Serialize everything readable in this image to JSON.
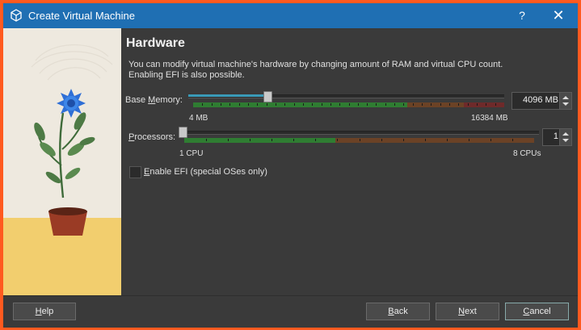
{
  "window": {
    "title": "Create Virtual Machine",
    "help_glyph": "?",
    "close_glyph": "✕"
  },
  "page": {
    "heading": "Hardware",
    "description_line1": "You can modify virtual machine's hardware by changing amount of RAM and virtual CPU count.",
    "description_line2": "Enabling EFI is also possible."
  },
  "memory": {
    "label_pre": "Base ",
    "label_accel": "M",
    "label_post": "emory:",
    "value": "4096 MB",
    "min_label": "4 MB",
    "max_label": "16384 MB",
    "level": 0.25
  },
  "processors": {
    "label_accel": "P",
    "label_post": "rocessors:",
    "value": "1",
    "min_label": "1 CPU",
    "max_label": "8 CPUs",
    "level": 0.0
  },
  "efi": {
    "accel": "E",
    "label": "nable EFI (special OSes only)",
    "checked": false
  },
  "footer": {
    "help_accel": "H",
    "help_rest": "elp",
    "back_accel": "B",
    "back_rest": "ack",
    "next_accel": "N",
    "next_rest": "ext",
    "cancel_accel": "C",
    "cancel_rest": "ancel"
  },
  "colors": {
    "title_bar": "#1f6fb3",
    "zone_green": "#2f7d32",
    "zone_brown": "#6b4226",
    "zone_red": "#6e2a2a",
    "flower_blue": "#2f6fd6"
  }
}
